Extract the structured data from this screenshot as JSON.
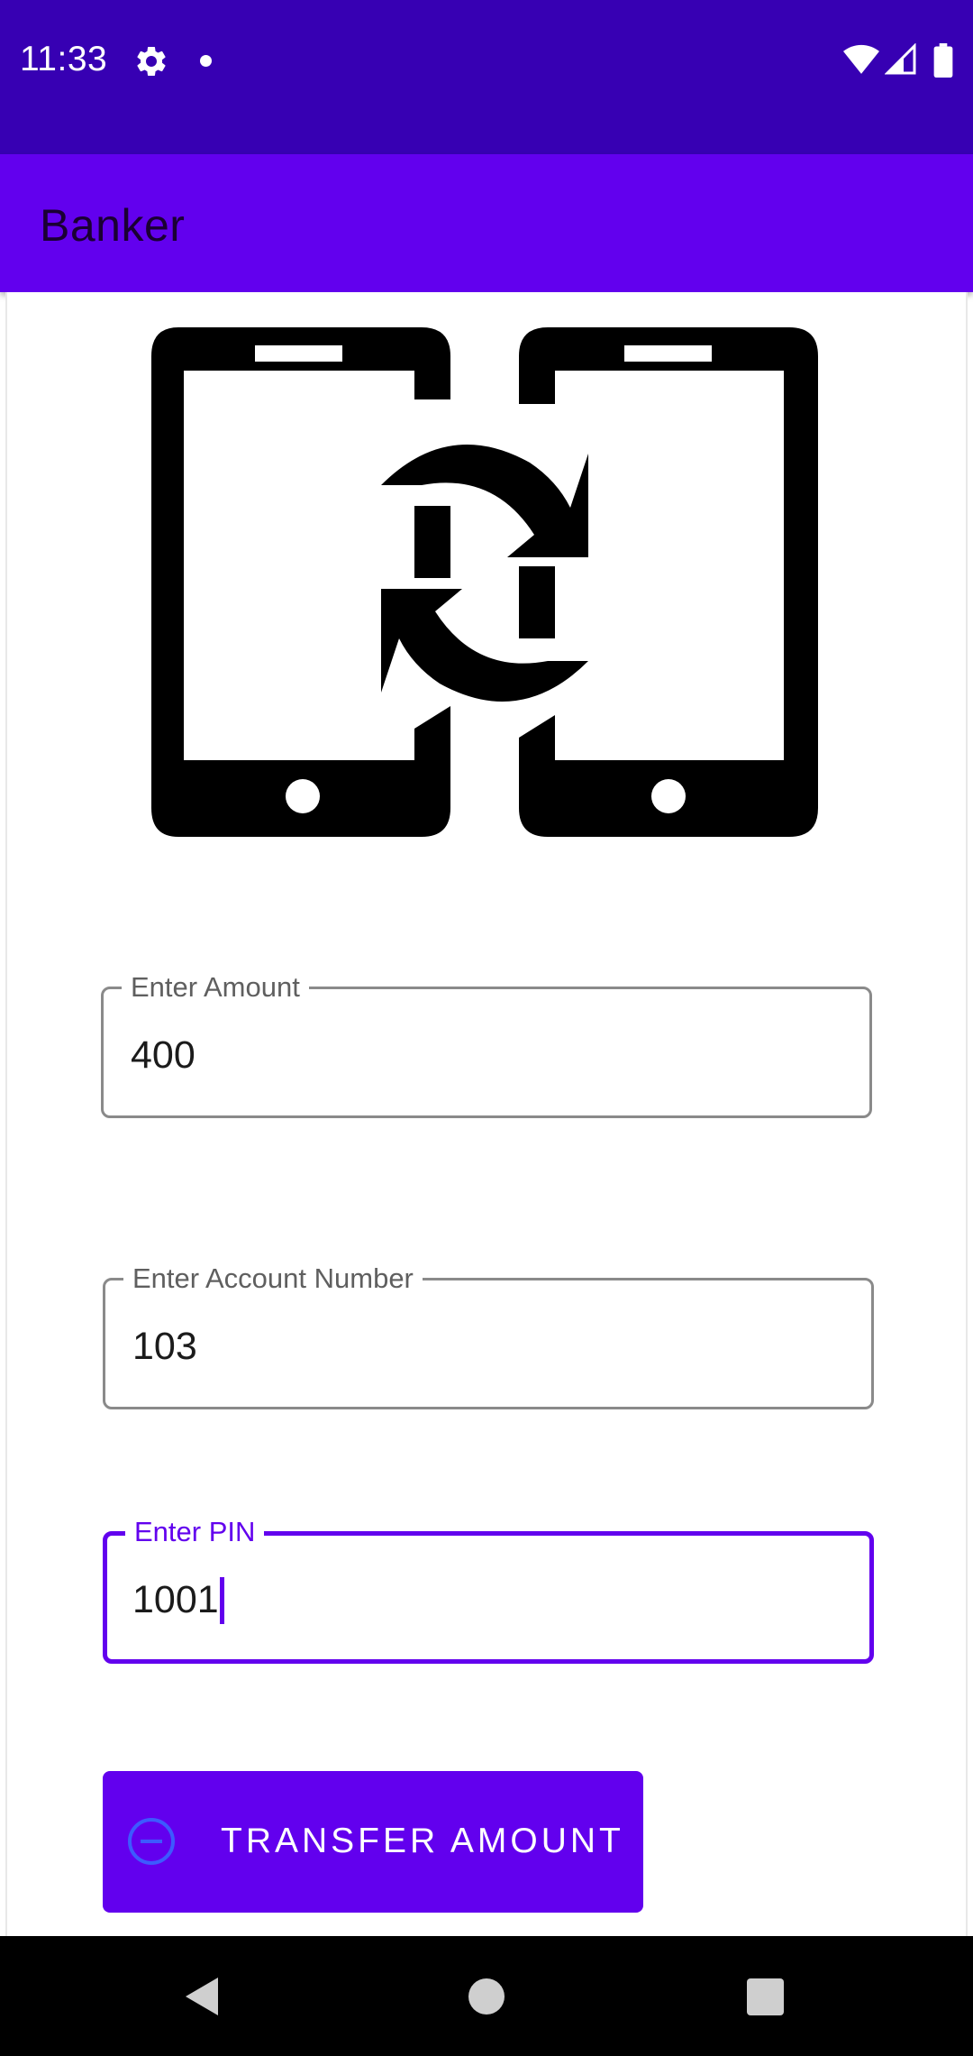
{
  "status_bar": {
    "time": "11:33",
    "icons": [
      "gear-icon",
      "notification-dot-icon",
      "wifi-icon",
      "cell-signal-icon",
      "battery-icon"
    ]
  },
  "app_bar": {
    "title": "Banker"
  },
  "illustration": {
    "icon": "phone-transfer-icon"
  },
  "form": {
    "amount": {
      "label": "Enter Amount",
      "value": "400"
    },
    "account": {
      "label": "Enter Account Number",
      "value": "103"
    },
    "pin": {
      "label": "Enter PIN",
      "value": "1001"
    }
  },
  "transfer_button": {
    "label": "TRANSFER AMOUNT",
    "icon": "remove-circle-icon"
  },
  "colors": {
    "status_bar": "#3700B3",
    "primary": "#6200EE",
    "nav_bar": "#000000"
  },
  "nav_bar": {
    "buttons": [
      "back-icon",
      "home-icon",
      "recents-icon"
    ]
  }
}
